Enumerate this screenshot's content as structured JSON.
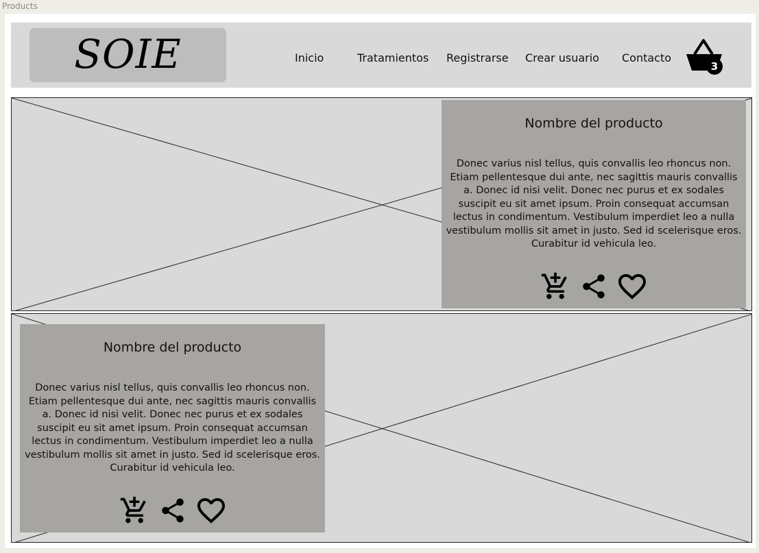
{
  "frame": {
    "label": "Products"
  },
  "header": {
    "logo": "SOIE",
    "nav": [
      {
        "label": "Inicio"
      },
      {
        "label": "Tratamientos"
      },
      {
        "label": "Registrarse"
      },
      {
        "label": "Crear usuario"
      },
      {
        "label": "Contacto"
      }
    ],
    "cart": {
      "icon": "basket-icon",
      "count": "3"
    }
  },
  "products": [
    {
      "name": "Nombre del producto",
      "description": "Donec varius nisl tellus, quis convallis leo rhoncus non. Etiam pellentesque dui ante, nec sagittis mauris convallis a. Donec id nisi velit. Donec nec purus et ex sodales suscipit eu sit amet ipsum. Proin consequat accumsan lectus in condimentum. Vestibulum imperdiet leo a nulla vestibulum mollis sit amet in justo. Sed id scelerisque eros. Curabitur id vehicula leo.",
      "actions": [
        "add-to-cart-icon",
        "share-icon",
        "heart-icon"
      ]
    },
    {
      "name": "Nombre del producto",
      "description": "Donec varius nisl tellus, quis convallis leo rhoncus non. Etiam pellentesque dui ante, nec sagittis mauris convallis a. Donec id nisi velit. Donec nec purus et ex sodales suscipit eu sit amet ipsum. Proin consequat accumsan lectus in condimentum. Vestibulum imperdiet leo a nulla vestibulum mollis sit amet in justo. Sed id scelerisque eros. Curabitur id vehicula leo.",
      "actions": [
        "add-to-cart-icon",
        "share-icon",
        "heart-icon"
      ]
    }
  ],
  "colors": {
    "background": "#eeede6",
    "header": "#d9d9d9",
    "logo_box": "#bdbdbd",
    "card": "#a6a5a2",
    "placeholder": "#d9d9d9"
  }
}
